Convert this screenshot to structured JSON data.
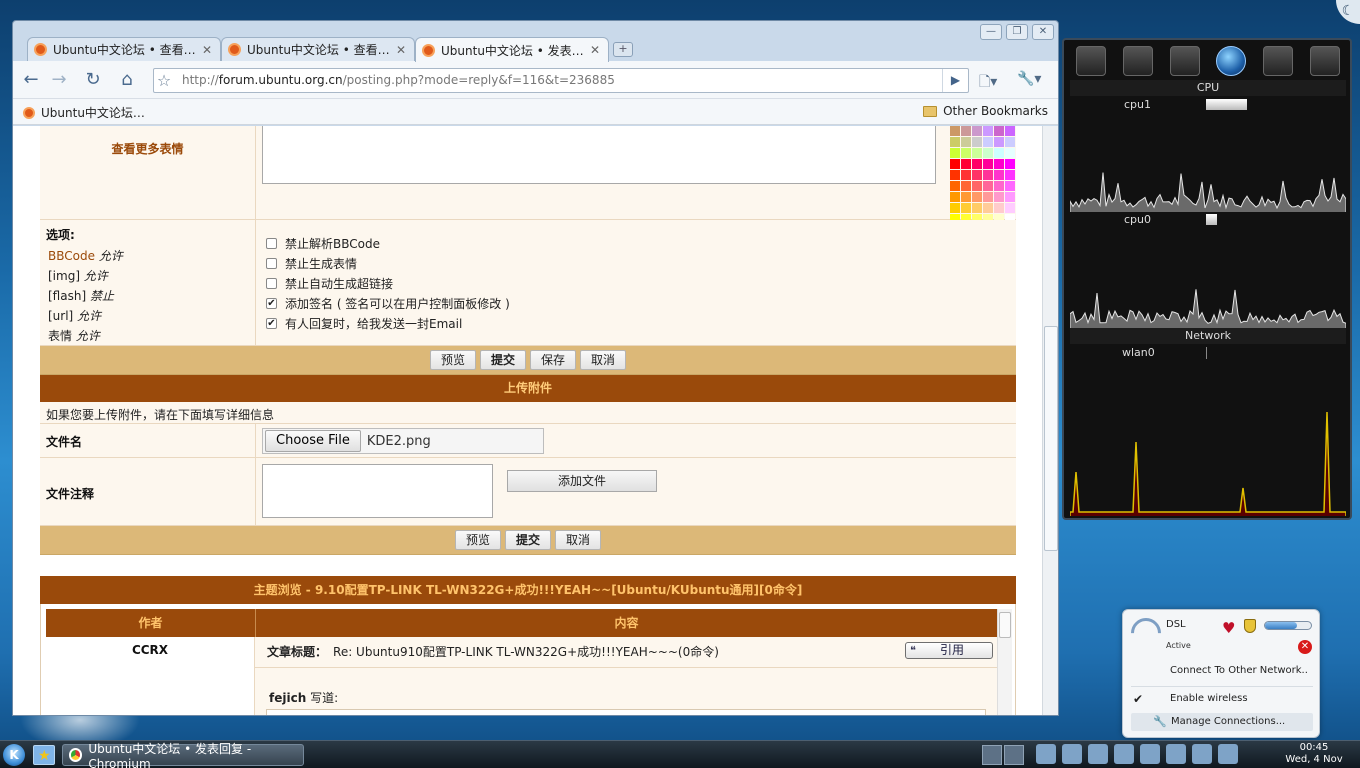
{
  "browser": {
    "tabs": [
      {
        "label": "Ubuntu中文论坛 • 查看…",
        "active": false
      },
      {
        "label": "Ubuntu中文论坛 • 查看…",
        "active": false
      },
      {
        "label": "Ubuntu中文论坛 • 发表…",
        "active": true
      }
    ],
    "close_glyph": "✕",
    "new_tab_glyph": "+",
    "window_buttons": {
      "minimize": "—",
      "maximize": "❐",
      "close": "✕"
    },
    "toolbar": {
      "back_glyph": "←",
      "forward_glyph": "→",
      "reload_glyph": "↻",
      "home_glyph": "⌂",
      "star_glyph": "☆",
      "go_glyph": "▶",
      "page_menu_glyph": "🗋▾",
      "wrench_menu_glyph": "🔧▾"
    },
    "url": {
      "prefix": "http://",
      "host": "forum.ubuntu.org.cn",
      "path": "/posting.php?mode=reply&f=116&t=236885"
    },
    "bookmarks": {
      "item": "Ubuntu中文论坛…",
      "other": "Other Bookmarks"
    }
  },
  "page": {
    "more_smilies": "查看更多表情",
    "palette_colors": [
      "#cc9966",
      "#cc9999",
      "#cc99cc",
      "#cc99ff",
      "#cc66cc",
      "#cc66ff",
      "#cccc66",
      "#cccc99",
      "#cccccc",
      "#ccccff",
      "#cc99ff",
      "#ccccff",
      "#ccff33",
      "#ccff66",
      "#ccff99",
      "#ccffcc",
      "#ccffff",
      "#e6ffff",
      "#ff0000",
      "#ff0033",
      "#ff0066",
      "#ff0099",
      "#ff00cc",
      "#ff00ff",
      "#ff3300",
      "#ff3333",
      "#ff3366",
      "#ff3399",
      "#ff33cc",
      "#ff33ff",
      "#ff6600",
      "#ff6633",
      "#ff6666",
      "#ff6699",
      "#ff66cc",
      "#ff66ff",
      "#ff9900",
      "#ff9933",
      "#ff9966",
      "#ff9999",
      "#ff99cc",
      "#ff99ff",
      "#ffcc00",
      "#ffcc33",
      "#ffcc66",
      "#ffcc99",
      "#ffcccc",
      "#ffccff",
      "#ffff00",
      "#ffff33",
      "#ffff66",
      "#ffff99",
      "#ffffcc",
      "#ffffff"
    ],
    "options": {
      "title": "选项:",
      "bbcode_link": "BBCode",
      "bbcode_state": "允许",
      "img": "[img]",
      "img_state": "允许",
      "flash": "[flash]",
      "flash_state": "禁止",
      "url": "[url]",
      "url_state": "允许",
      "smilies": "表情",
      "smilies_state": "允许"
    },
    "checkboxes": [
      {
        "label": "禁止解析BBCode",
        "checked": false
      },
      {
        "label": "禁止生成表情",
        "checked": false
      },
      {
        "label": "禁止自动生成超链接",
        "checked": false
      },
      {
        "label": "添加签名 ( 签名可以在用户控制面板修改 )",
        "checked": true
      },
      {
        "label": "有人回复时，给我发送一封Email",
        "checked": true
      }
    ],
    "check_mark": "✔",
    "buttons1": {
      "preview": "预览",
      "submit": "提交",
      "save": "保存",
      "cancel": "取消"
    },
    "upload": {
      "header": "上传附件",
      "info": "如果您要上传附件，请在下面填写详细信息",
      "filename_label": "文件名",
      "choose_file": "Choose File",
      "file_value": "KDE2.png",
      "comment_label": "文件注释",
      "add_file": "添加文件"
    },
    "buttons2": {
      "preview": "预览",
      "submit": "提交",
      "cancel": "取消"
    },
    "topic": {
      "header": "主题浏览 - 9.10配置TP-LINK TL-WN322G+成功!!!YEAH~~[Ubuntu/KUbuntu通用][0命令]",
      "col_author": "作者",
      "col_content": "内容",
      "author": "CCRX",
      "subject_label": "文章标题：",
      "subject": "Re: Ubuntu910配置TP-LINK TL-WN322G+成功!!!YEAH~~~(0命令)",
      "quote_button": "引用",
      "quote_icon": "❝",
      "quote_author": "fejich",
      "quote_wrote": "写道:"
    }
  },
  "sysmon": {
    "cpu_title": "CPU",
    "cpu1_label": "cpu1",
    "cpu1_load": 0.3,
    "cpu0_label": "cpu0",
    "cpu0_load": 0.08,
    "network_title": "Network",
    "wlan_label": "wlan0",
    "line_color": "#e0c000",
    "graph_color": "#bbbbbb"
  },
  "network_popup": {
    "name": "DSL",
    "status": "Active",
    "connect_other": "Connect To Other Network..",
    "enable_wireless": "Enable wireless",
    "manage": "Manage Connections...",
    "disconnect_glyph": "✕",
    "heart_glyph": "♥",
    "check_glyph": "✔",
    "wrench_glyph": "🔧",
    "signal_level": 0.7
  },
  "taskbar": {
    "kmenu_glyph": "K",
    "star_glyph": "★",
    "task_title": "Ubuntu中文论坛 • 发表回复 - Chromium",
    "clock_time": "00:45",
    "clock_date": "Wed, 4 Nov"
  },
  "desktop": {
    "corner_glyph": "☾"
  }
}
